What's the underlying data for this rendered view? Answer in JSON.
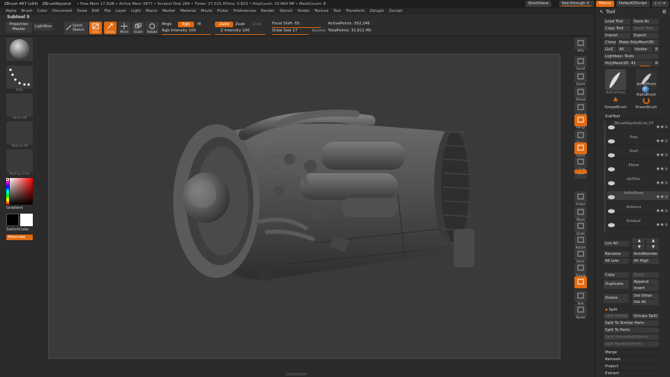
{
  "titlebar": {
    "app": "ZBrush 4R7 (x64)",
    "doc": "ZBrushKeyshot",
    "stats": "• Free Mem 17.5GB • Active Mem 3977 • Scratch Disk 264 • Timer: 27.515 ATime: 0.823 • PolyCount: 33.864 MP • MeshCount: 8",
    "quicksave": "QuickSave",
    "see_through": "See-through 0",
    "menus": "Menus",
    "default_script": "DefaultZScript"
  },
  "menubar": [
    "Alpha",
    "Brush",
    "Color",
    "Document",
    "Draw",
    "Edit",
    "File",
    "Layer",
    "Light",
    "Macro",
    "Marker",
    "Material",
    "Movie",
    "Picker",
    "Preferences",
    "Render",
    "Stencil",
    "Stroke",
    "Texture",
    "Tool",
    "Transform",
    "Zplugin",
    "Zscript"
  ],
  "toolbar": {
    "subtool_label": "Subtool 5",
    "projection_master": "Projection Master",
    "lightbox": "LightBox",
    "quick_sketch": "Quick Sketch",
    "edit": "Edit",
    "draw": "Draw",
    "move": "Move",
    "scale": "Scale",
    "rotate": "Rotate",
    "mrgb": "Mrgb",
    "rgb": "Rgb",
    "m": "M",
    "rgb_intensity": "Rgb Intensity 100",
    "zadd": "Zadd",
    "zsub": "Zsub",
    "zcut": "Zcut",
    "z_intensity": "Z Intensity 100",
    "focal_shift": "Focal Shift -55",
    "draw_size": "Draw Size 17",
    "dynamic": "Dynamic",
    "active_points": "ActivePoints: 352,246",
    "total_points": "TotalPoints: 31.611 Mil"
  },
  "left": {
    "thumb_labels": [
      "",
      "Dots",
      "Alpha Off",
      "Texture Off",
      "MatCap Gray"
    ],
    "gradient": "Gradient",
    "switch_color": "SwitchColor",
    "alternate": "Alternate",
    "colors": {
      "primary": "#000000",
      "secondary": "#ffffff"
    }
  },
  "right_shelf": [
    "SPix",
    "Scroll",
    "Zoom",
    "Actual",
    "AAHalf",
    "Persp",
    "Floor",
    "Local",
    "L.Sym",
    "XYZ",
    "",
    "Frame",
    "Move",
    "Scale",
    "Rotate",
    "PolyF",
    "Transp",
    "",
    "Solo",
    "Xpose"
  ],
  "panel": {
    "title": "Tool",
    "load_tool": "Load Tool",
    "save_as": "Save As",
    "copy_tool": "Copy Tool",
    "paste_tool": "Paste Tool",
    "import": "Import",
    "export": "Export",
    "clone": "Clone",
    "make_polymesh": "Make PolyMesh3D",
    "goz": "GoZ",
    "all": "All",
    "visible": "Visible",
    "r": "R",
    "lightbox_tools": "Lightbox› Tools",
    "current_tool": "PolyMesh3D. 41",
    "thumb_labels": [
      "AirFoilFront",
      "AirFoilFront",
      "AlphaBrush",
      "SimpleBrush",
      "EraserBrush"
    ],
    "subtool_header": "SubTool",
    "subtools": [
      "ZBrushKeyshotLink_07",
      "Prop",
      "Shell",
      "Elbow",
      "AirFilter",
      "AirFoilFront",
      "Antenna",
      "Exhaust"
    ],
    "list_all": "List All",
    "rename": "Rename",
    "auto_reorder": "AutoReorder",
    "all_low": "All Low",
    "all_high": "All High",
    "copy": "Copy",
    "paste": "Paste",
    "duplicate": "Duplicate",
    "append": "Append",
    "insert": "Insert",
    "delete": "Delete",
    "del_other": "Del Other",
    "del_all": "Del All",
    "split": "Split",
    "split_hidden": "Split Hidden",
    "groups_split": "Groups Split",
    "split_similar": "Split To Similar Parts",
    "split_parts": "Split To Parts",
    "split_unmasked": "Split Unmasked Points",
    "split_masked": "Split Masked Points",
    "merge": "Merge",
    "remesh": "Remesh",
    "project": "Project",
    "extract": "Extract"
  },
  "colors": {
    "accent": "#e06a10",
    "bg": "#2a2a2a",
    "viewport": "#3a3a3a"
  }
}
